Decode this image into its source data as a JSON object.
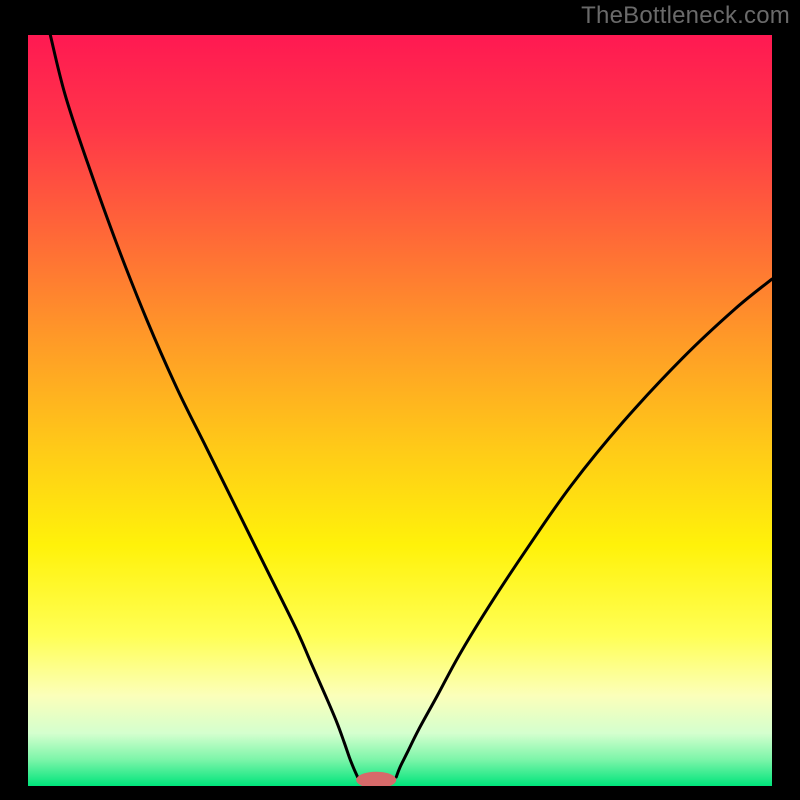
{
  "watermark": "TheBottleneck.com",
  "chart_data": {
    "type": "line",
    "title": "",
    "xlabel": "",
    "ylabel": "",
    "xlim": [
      0,
      100
    ],
    "ylim": [
      0,
      100
    ],
    "legend": false,
    "grid": false,
    "background_gradient_stops": [
      {
        "offset": 0.0,
        "color": "#ff1952"
      },
      {
        "offset": 0.12,
        "color": "#ff3549"
      },
      {
        "offset": 0.26,
        "color": "#ff6638"
      },
      {
        "offset": 0.4,
        "color": "#ff9828"
      },
      {
        "offset": 0.55,
        "color": "#ffca18"
      },
      {
        "offset": 0.68,
        "color": "#fff20a"
      },
      {
        "offset": 0.8,
        "color": "#ffff55"
      },
      {
        "offset": 0.88,
        "color": "#fbffba"
      },
      {
        "offset": 0.93,
        "color": "#d4ffce"
      },
      {
        "offset": 0.965,
        "color": "#7cf5a9"
      },
      {
        "offset": 1.0,
        "color": "#00e47b"
      }
    ],
    "series": [
      {
        "name": "left-branch",
        "x": [
          3,
          5,
          8,
          12,
          16,
          20,
          24,
          28,
          32,
          36,
          38,
          40,
          41.5,
          42.5,
          43.2,
          43.8,
          44.3
        ],
        "y": [
          100,
          92,
          83,
          72,
          62,
          53,
          45,
          37,
          29,
          21,
          16.5,
          12,
          8.5,
          5.8,
          3.8,
          2.3,
          1.2
        ]
      },
      {
        "name": "right-branch",
        "x": [
          49.5,
          50,
          51,
          52.5,
          55,
          58,
          62,
          67,
          73,
          80,
          88,
          95,
          100
        ],
        "y": [
          1.2,
          2.5,
          4.5,
          7.5,
          12,
          17.5,
          24,
          31.5,
          40,
          48.5,
          57,
          63.5,
          67.5
        ]
      }
    ],
    "marker": {
      "name": "minimum-marker",
      "cx": 46.8,
      "cy": 0.8,
      "rx": 2.7,
      "ry": 1.1,
      "color": "#d76a6a"
    },
    "frame": {
      "top_width": 35,
      "side_width": 28,
      "bottom_width": 14,
      "color": "#000000"
    }
  }
}
